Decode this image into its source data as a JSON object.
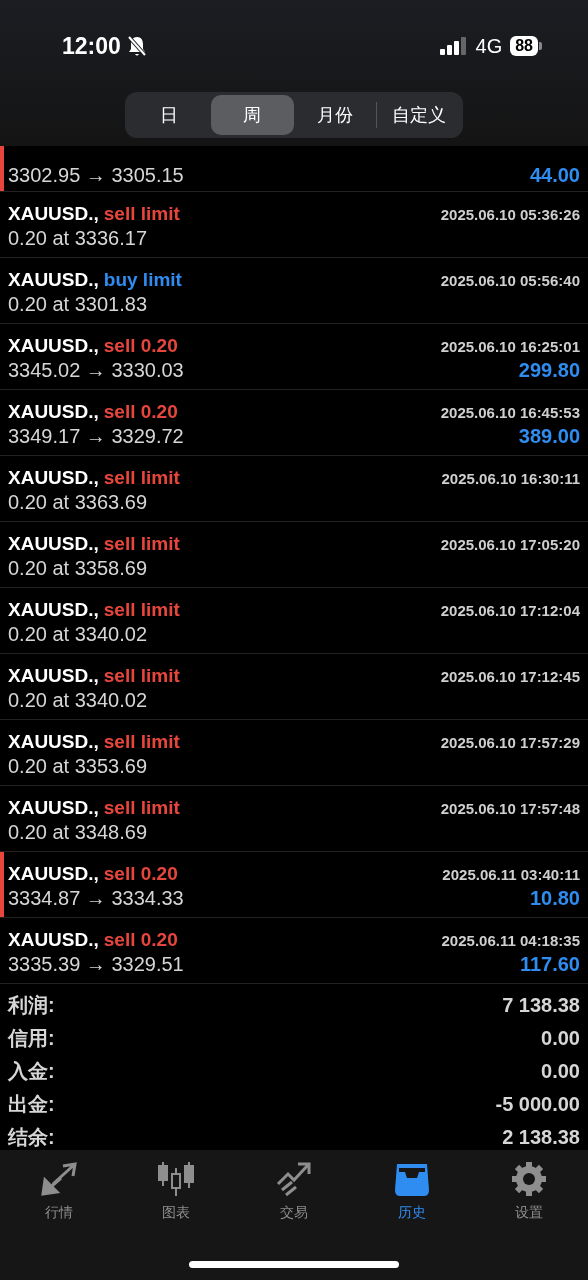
{
  "status_bar": {
    "time": "12:00",
    "network": "4G",
    "battery": "88"
  },
  "period_tabs": [
    {
      "label": "日",
      "selected": false
    },
    {
      "label": "周",
      "selected": true
    },
    {
      "label": "月份",
      "selected": false
    },
    {
      "label": "自定义",
      "selected": false
    }
  ],
  "history": [
    {
      "kind": "deal",
      "marked": true,
      "detail": "3302.95 → 3305.15",
      "profit": "44.00"
    },
    {
      "kind": "order",
      "color": "#e8463c",
      "marked": false,
      "symbol": "XAUUSD.,",
      "action": "sell limit",
      "time": "2025.06.10 05:36:26",
      "detail": "0.20 at 3336.17"
    },
    {
      "kind": "order",
      "color": "#2f8cf0",
      "marked": false,
      "symbol": "XAUUSD.,",
      "action": "buy limit",
      "time": "2025.06.10 05:56:40",
      "detail": "0.20 at 3301.83"
    },
    {
      "kind": "deal",
      "color": "#e8463c",
      "marked": false,
      "symbol": "XAUUSD.,",
      "action": "sell 0.20",
      "time": "2025.06.10 16:25:01",
      "detail": "3345.02 → 3330.03",
      "profit": "299.80"
    },
    {
      "kind": "deal",
      "color": "#e8463c",
      "marked": false,
      "symbol": "XAUUSD.,",
      "action": "sell 0.20",
      "time": "2025.06.10 16:45:53",
      "detail": "3349.17 → 3329.72",
      "profit": "389.00"
    },
    {
      "kind": "order",
      "color": "#e8463c",
      "marked": false,
      "symbol": "XAUUSD.,",
      "action": "sell limit",
      "time": "2025.06.10 16:30:11",
      "detail": "0.20 at 3363.69"
    },
    {
      "kind": "order",
      "color": "#e8463c",
      "marked": false,
      "symbol": "XAUUSD.,",
      "action": "sell limit",
      "time": "2025.06.10 17:05:20",
      "detail": "0.20 at 3358.69"
    },
    {
      "kind": "order",
      "color": "#e8463c",
      "marked": false,
      "symbol": "XAUUSD.,",
      "action": "sell limit",
      "time": "2025.06.10 17:12:04",
      "detail": "0.20 at 3340.02"
    },
    {
      "kind": "order",
      "color": "#e8463c",
      "marked": false,
      "symbol": "XAUUSD.,",
      "action": "sell limit",
      "time": "2025.06.10 17:12:45",
      "detail": "0.20 at 3340.02"
    },
    {
      "kind": "order",
      "color": "#e8463c",
      "marked": false,
      "symbol": "XAUUSD.,",
      "action": "sell limit",
      "time": "2025.06.10 17:57:29",
      "detail": "0.20 at 3353.69"
    },
    {
      "kind": "order",
      "color": "#e8463c",
      "marked": false,
      "symbol": "XAUUSD.,",
      "action": "sell limit",
      "time": "2025.06.10 17:57:48",
      "detail": "0.20 at 3348.69"
    },
    {
      "kind": "deal",
      "color": "#e8463c",
      "marked": true,
      "symbol": "XAUUSD.,",
      "action": "sell 0.20",
      "time": "2025.06.11 03:40:11",
      "detail": "3334.87 → 3334.33",
      "profit": "10.80"
    },
    {
      "kind": "deal",
      "color": "#e8463c",
      "marked": false,
      "symbol": "XAUUSD.,",
      "action": "sell 0.20",
      "time": "2025.06.11 04:18:35",
      "detail": "3335.39 → 3329.51",
      "profit": "117.60"
    }
  ],
  "summary": [
    {
      "label": "利润:",
      "value": "7 138.38"
    },
    {
      "label": "信用:",
      "value": "0.00"
    },
    {
      "label": "入金:",
      "value": "0.00"
    },
    {
      "label": "出金:",
      "value": "-5 000.00"
    },
    {
      "label": "结余:",
      "value": "2 138.38"
    }
  ],
  "tab_bar": [
    {
      "kind": "quotes",
      "label": "行情",
      "selected": false
    },
    {
      "kind": "chart",
      "label": "图表",
      "selected": false
    },
    {
      "kind": "trade",
      "label": "交易",
      "selected": false
    },
    {
      "kind": "history",
      "label": "历史",
      "selected": true
    },
    {
      "kind": "settings",
      "label": "设置",
      "selected": false
    }
  ]
}
